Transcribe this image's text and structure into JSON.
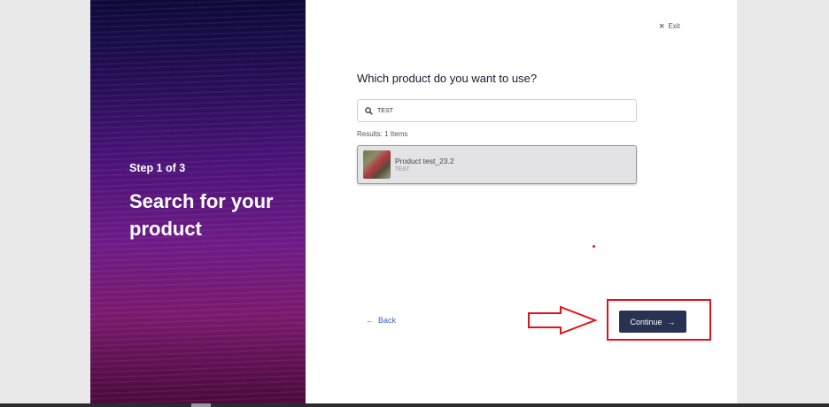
{
  "left_panel": {
    "step": "Step 1 of 3",
    "title": "Search for your product"
  },
  "exit_label": "Exit",
  "question": "Which product do you want to use?",
  "search": {
    "value": "TEST",
    "icon": "search-icon"
  },
  "results": {
    "count_label": "Results: 1 Items",
    "items": [
      {
        "name": "Product test_23.2",
        "subtitle": "TEST"
      }
    ]
  },
  "footer": {
    "back_label": "Back",
    "back_arrow": "←",
    "continue_label": "Continue",
    "continue_arrow": "→"
  },
  "colors": {
    "primary_button": "#283253",
    "link": "#3a5fd0",
    "annotation_red": "#e0141a"
  }
}
